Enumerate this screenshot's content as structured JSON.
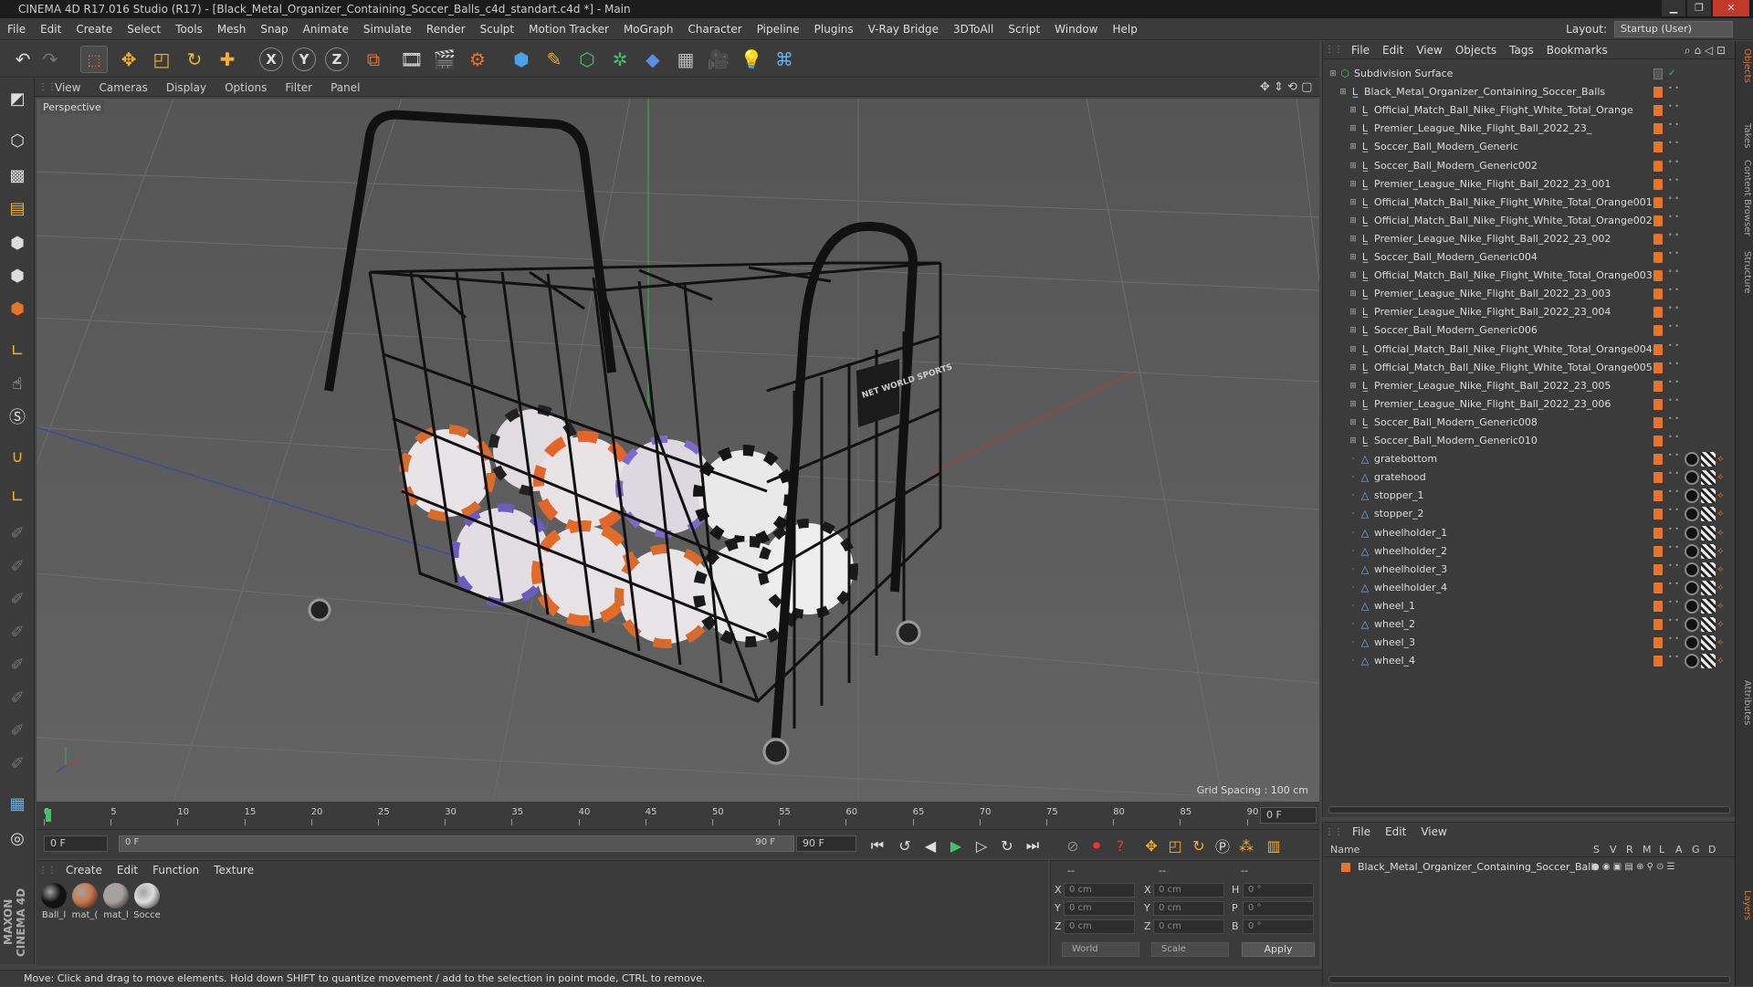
{
  "window": {
    "title": "CINEMA 4D R17.016 Studio (R17) - [Black_Metal_Organizer_Containing_Soccer_Balls_c4d_standart.c4d *] - Main",
    "minimize": "▁",
    "maximize": "❐",
    "close": "✕"
  },
  "menubar": [
    "File",
    "Edit",
    "Create",
    "Select",
    "Tools",
    "Mesh",
    "Snap",
    "Animate",
    "Simulate",
    "Render",
    "Sculpt",
    "Motion Tracker",
    "MoGraph",
    "Character",
    "Pipeline",
    "Plugins",
    "V-Ray Bridge",
    "3DToAll",
    "Script",
    "Window",
    "Help"
  ],
  "layout": {
    "label": "Layout:",
    "value": "Startup (User)"
  },
  "toolbar": {
    "x_axis": "X",
    "y_axis": "Y",
    "z_axis": "Z"
  },
  "viewport_menu": [
    "View",
    "Cameras",
    "Display",
    "Options",
    "Filter",
    "Panel"
  ],
  "viewport": {
    "camera": "Perspective",
    "grid_spacing": "Grid Spacing : 100 cm",
    "sign_text": "NET WORLD SPORTS"
  },
  "timeline": {
    "ticks": [
      "0",
      "5",
      "10",
      "15",
      "20",
      "25",
      "30",
      "35",
      "40",
      "45",
      "50",
      "55",
      "60",
      "65",
      "70",
      "75",
      "80",
      "85",
      "90"
    ],
    "end_frame": "0 F"
  },
  "timectrl": {
    "start": "0 F",
    "range_start": "0 F",
    "range_end": "90 F",
    "end": "90 F"
  },
  "material_menu": [
    "Create",
    "Edit",
    "Function",
    "Texture"
  ],
  "materials": [
    {
      "name": "Ball_l",
      "color": "#111111"
    },
    {
      "name": "mat_(",
      "color": "#c9764a"
    },
    {
      "name": "mat_l",
      "color": "#a8a0a0"
    },
    {
      "name": "Socce",
      "color": "#dddddd"
    }
  ],
  "coords": {
    "headers": [
      "--",
      "--",
      "--"
    ],
    "rows": [
      {
        "a": "X",
        "av": "0 cm",
        "b": "X",
        "bv": "0 cm",
        "c": "H",
        "cv": "0 °"
      },
      {
        "a": "Y",
        "av": "0 cm",
        "b": "Y",
        "bv": "0 cm",
        "c": "P",
        "cv": "0 °"
      },
      {
        "a": "Z",
        "av": "0 cm",
        "b": "Z",
        "bv": "0 cm",
        "c": "B",
        "cv": "0 °"
      }
    ],
    "world": "World",
    "scale": "Scale",
    "apply": "Apply"
  },
  "status": "Move: Click and drag to move elements. Hold down SHIFT to quantize movement / add to the selection in point mode, CTRL to remove.",
  "object_menu": [
    "File",
    "Edit",
    "View",
    "Objects",
    "Tags",
    "Bookmarks"
  ],
  "objects": [
    {
      "name": "Subdivision Surface",
      "level": 0,
      "type": "subd"
    },
    {
      "name": "Black_Metal_Organizer_Containing_Soccer_Balls",
      "level": 1,
      "type": "null"
    },
    {
      "name": "Official_Match_Ball_Nike_Flight_White_Total_Orange",
      "level": 2,
      "type": "null"
    },
    {
      "name": "Premier_League_Nike_Flight_Ball_2022_23_",
      "level": 2,
      "type": "null"
    },
    {
      "name": "Soccer_Ball_Modern_Generic",
      "level": 2,
      "type": "null"
    },
    {
      "name": "Soccer_Ball_Modern_Generic002",
      "level": 2,
      "type": "null"
    },
    {
      "name": "Premier_League_Nike_Flight_Ball_2022_23_001",
      "level": 2,
      "type": "null"
    },
    {
      "name": "Official_Match_Ball_Nike_Flight_White_Total_Orange001",
      "level": 2,
      "type": "null"
    },
    {
      "name": "Official_Match_Ball_Nike_Flight_White_Total_Orange002",
      "level": 2,
      "type": "null"
    },
    {
      "name": "Premier_League_Nike_Flight_Ball_2022_23_002",
      "level": 2,
      "type": "null"
    },
    {
      "name": "Soccer_Ball_Modern_Generic004",
      "level": 2,
      "type": "null"
    },
    {
      "name": "Official_Match_Ball_Nike_Flight_White_Total_Orange003",
      "level": 2,
      "type": "null"
    },
    {
      "name": "Premier_League_Nike_Flight_Ball_2022_23_003",
      "level": 2,
      "type": "null"
    },
    {
      "name": "Premier_League_Nike_Flight_Ball_2022_23_004",
      "level": 2,
      "type": "null"
    },
    {
      "name": "Soccer_Ball_Modern_Generic006",
      "level": 2,
      "type": "null"
    },
    {
      "name": "Official_Match_Ball_Nike_Flight_White_Total_Orange004",
      "level": 2,
      "type": "null"
    },
    {
      "name": "Official_Match_Ball_Nike_Flight_White_Total_Orange005",
      "level": 2,
      "type": "null"
    },
    {
      "name": "Premier_League_Nike_Flight_Ball_2022_23_005",
      "level": 2,
      "type": "null"
    },
    {
      "name": "Premier_League_Nike_Flight_Ball_2022_23_006",
      "level": 2,
      "type": "null"
    },
    {
      "name": "Soccer_Ball_Modern_Generic008",
      "level": 2,
      "type": "null"
    },
    {
      "name": "Soccer_Ball_Modern_Generic010",
      "level": 2,
      "type": "null"
    },
    {
      "name": "gratebottom",
      "level": 2,
      "type": "mesh"
    },
    {
      "name": "gratehood",
      "level": 2,
      "type": "mesh"
    },
    {
      "name": "stopper_1",
      "level": 2,
      "type": "mesh"
    },
    {
      "name": "stopper_2",
      "level": 2,
      "type": "mesh"
    },
    {
      "name": "wheelholder_1",
      "level": 2,
      "type": "mesh"
    },
    {
      "name": "wheelholder_2",
      "level": 2,
      "type": "mesh"
    },
    {
      "name": "wheelholder_3",
      "level": 2,
      "type": "mesh"
    },
    {
      "name": "wheelholder_4",
      "level": 2,
      "type": "mesh"
    },
    {
      "name": "wheel_1",
      "level": 2,
      "type": "mesh"
    },
    {
      "name": "wheel_2",
      "level": 2,
      "type": "mesh"
    },
    {
      "name": "wheel_3",
      "level": 2,
      "type": "mesh"
    },
    {
      "name": "wheel_4",
      "level": 2,
      "type": "mesh"
    }
  ],
  "right_tabs": [
    "Objects",
    "Takes",
    "Content Browser",
    "Structure",
    "Attributes",
    "Layers"
  ],
  "layer_menu": [
    "File",
    "Edit",
    "View"
  ],
  "layer_header": {
    "name": "Name",
    "cols": [
      "S",
      "V",
      "R",
      "M",
      "L",
      "A",
      "G",
      "D"
    ]
  },
  "layer_row": {
    "name": "Black_Metal_Organizer_Containing_Soccer_Balls"
  },
  "colors": {
    "accent": "#e8742b",
    "bg": "#3b3b3b"
  }
}
